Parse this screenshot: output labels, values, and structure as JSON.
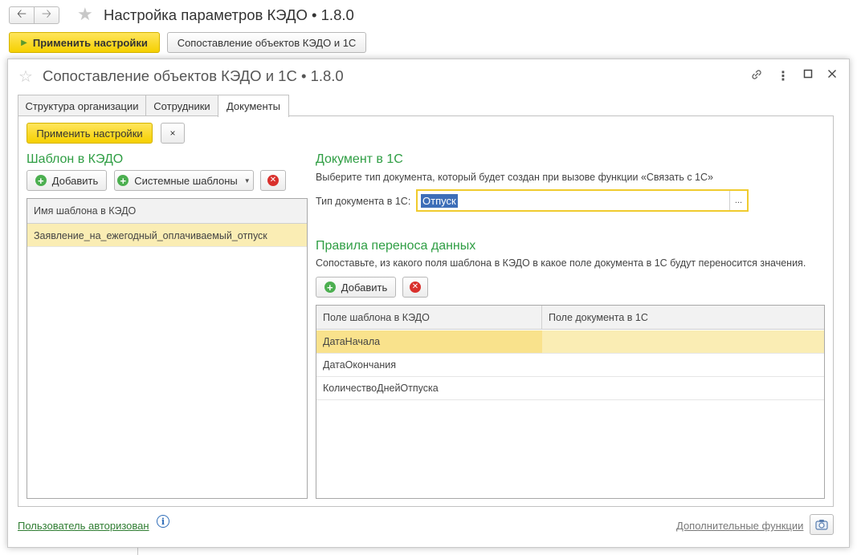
{
  "window": {
    "back_icon": "arrow-left-icon",
    "forward_icon": "arrow-right-icon",
    "favorite_icon": "star-icon",
    "title": "Настройка параметров КЭДО • 1.8.0"
  },
  "toolbar": {
    "apply_label": "Применить настройки",
    "mapping_label": "Сопоставление объектов КЭДО и 1С"
  },
  "dialog": {
    "title": "Сопоставление объектов КЭДО и 1С • 1.8.0",
    "icons": [
      "link-icon",
      "more-icon",
      "maximize-icon",
      "close-icon"
    ],
    "tabs": [
      {
        "label": "Структура организации",
        "active": false
      },
      {
        "label": "Сотрудники",
        "active": false
      },
      {
        "label": "Документы",
        "active": true
      }
    ],
    "apply_label": "Применить настройки",
    "close_small": "×",
    "template": {
      "heading": "Шаблон в КЭДО",
      "add_label": "Добавить",
      "system_label": "Системные шаблоны",
      "column": "Имя шаблона в КЭДО",
      "rows": [
        "Заявление_на_ежегодный_оплачиваемый_отпуск"
      ]
    },
    "document": {
      "heading": "Документ в 1С",
      "hint": "Выберите тип документа, который будет создан при вызове функции «Связать с 1С»",
      "type_label": "Тип документа в 1С:",
      "type_value": "Отпуск",
      "pick_label": "..."
    },
    "rules": {
      "heading": "Правила переноса данных",
      "hint": "Сопоставьте, из какого поля шаблона в КЭДО в какое поле документа в 1С будут переносится значения.",
      "add_label": "Добавить",
      "columns": [
        "Поле шаблона в КЭДО",
        "Поле документа в 1С"
      ],
      "rows": [
        {
          "field": "ДатаНачала",
          "doc_field": ""
        },
        {
          "field": "ДатаОкончания",
          "doc_field": ""
        },
        {
          "field": "КоличествоДнейОтпуска",
          "doc_field": ""
        }
      ]
    },
    "footer": {
      "auth_link": "Пользователь авторизован",
      "info_icon": "i",
      "more_link": "Дополнительные функции",
      "screenshot_icon": "camera-icon"
    }
  },
  "colors": {
    "accent_yellow": "#f5d000",
    "heading_green": "#2f9e44",
    "selection_row": "#faedb4",
    "selected_text_bg": "#3d6eb8"
  }
}
